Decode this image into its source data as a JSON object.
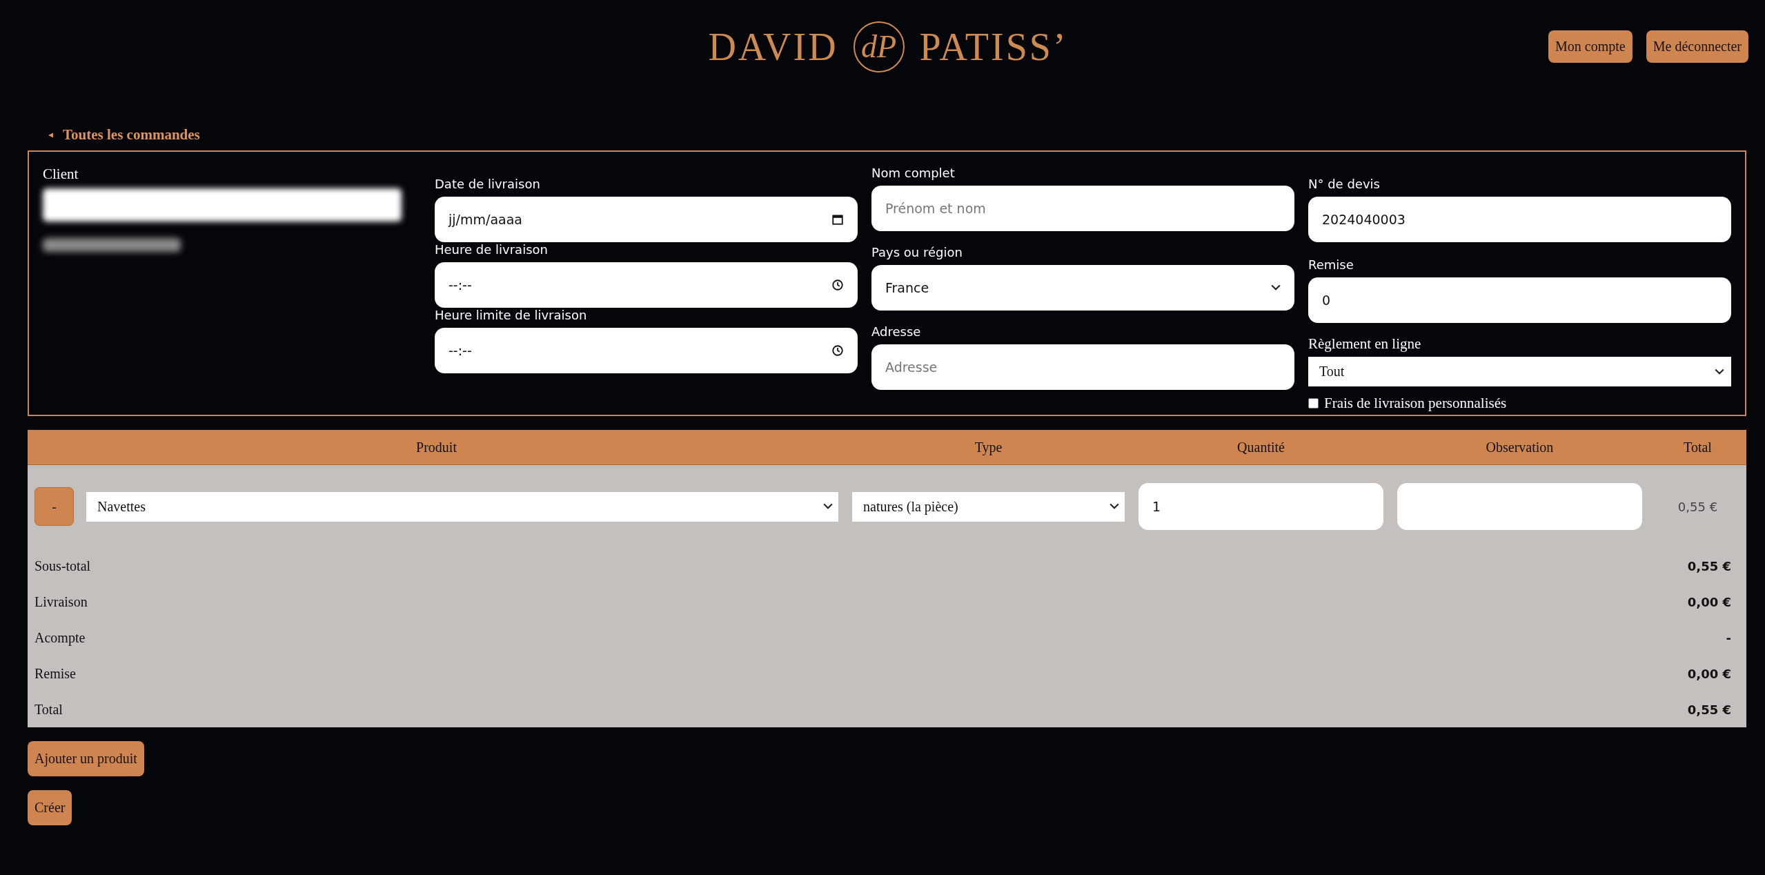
{
  "header": {
    "logo": {
      "left": "DAVID",
      "monogram": "dP",
      "right": "PATISS’"
    },
    "buttons": [
      "Mon compte",
      "Me déconnecter"
    ]
  },
  "back_link": {
    "label": "Toutes les commandes"
  },
  "form": {
    "client": {
      "label": "Client"
    },
    "columns": [
      [
        {
          "kind": "date",
          "label": "Date de livraison",
          "placeholder": "jj/mm/aaaa"
        },
        {
          "kind": "time",
          "label": "Heure de livraison",
          "placeholder": "--:--"
        },
        {
          "kind": "time",
          "label": "Heure limite de livraison",
          "placeholder": "--:--"
        }
      ],
      [
        {
          "kind": "text",
          "label": "Nom complet",
          "placeholder": "Prénom et nom"
        },
        {
          "kind": "select",
          "label": "Pays ou région",
          "value": "France"
        },
        {
          "kind": "text",
          "label": "Adresse",
          "placeholder": "Adresse"
        }
      ],
      [
        {
          "kind": "text",
          "label": "N° de devis",
          "value": "2024040003"
        },
        {
          "kind": "text",
          "label": "Remise",
          "value": "0"
        },
        {
          "kind": "native-select",
          "label": "Règlement en ligne",
          "value": "Tout"
        },
        {
          "kind": "checkbox",
          "label": "Frais de livraison personnalisés",
          "checked": false
        }
      ]
    ]
  },
  "table": {
    "columns": [
      "Produit",
      "Type",
      "Quantité",
      "Observation",
      "Total"
    ],
    "rows": [
      {
        "remove": "-",
        "product": "Navettes",
        "type": "natures (la pièce)",
        "quantity": "1",
        "total": "0,55 €"
      }
    ],
    "summary": [
      {
        "label": "Sous-total",
        "value": "0,55 €"
      },
      {
        "label": "Livraison",
        "value": "0,00 €"
      },
      {
        "label": "Acompte",
        "value": "-"
      },
      {
        "label": "Remise",
        "value": "0,00 €"
      },
      {
        "label": "Total",
        "value": "0,55 €"
      }
    ]
  },
  "actions": [
    "Ajouter un produit",
    "Créer"
  ]
}
